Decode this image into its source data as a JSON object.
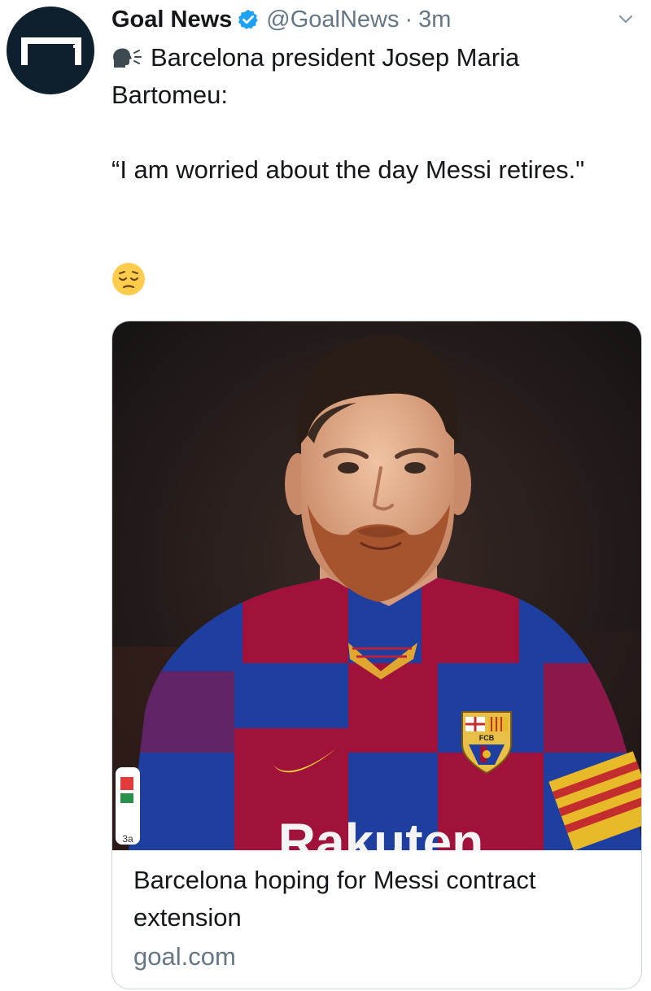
{
  "tweet": {
    "author": {
      "display_name": "Goal News",
      "handle": "@GoalNews",
      "verified": true,
      "avatar_icon": "goal-logo-icon"
    },
    "separator": "·",
    "time": "3m",
    "text": {
      "line1_icon": "speaking-head-icon",
      "line1": "Barcelona president Josep Maria Bartomeu:",
      "quote": "“I am worried about the day Messi retires.\"",
      "emoji_icon": "pensive-face-icon"
    },
    "card": {
      "image_icon": "player-photo-icon",
      "image_text": {
        "sponsor": "Rakuten",
        "crest_text": "FCB",
        "sleeve_text": "3a"
      },
      "title": "Barcelona hoping for Messi contract extension",
      "domain": "goal.com"
    }
  },
  "colors": {
    "verified": "#1da1f2",
    "secondary_text": "#657786",
    "avatar_bg": "#0e1f2e",
    "shirt_blue": "#1f3fa0",
    "shirt_red": "#a0123a"
  }
}
